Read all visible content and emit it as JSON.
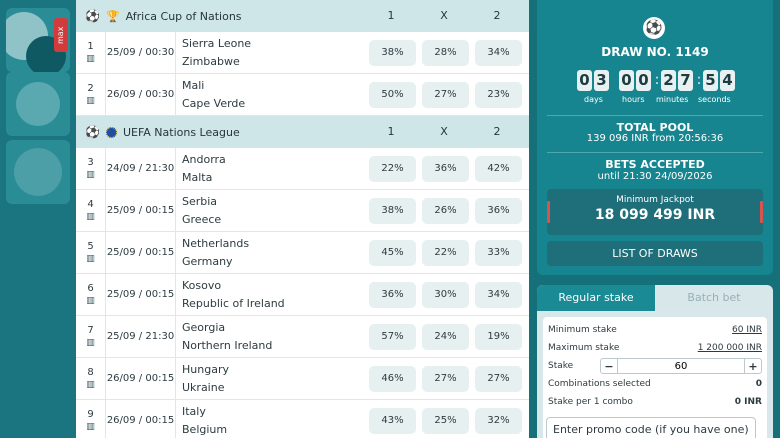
{
  "left_rail": {
    "tiles": [
      {
        "name": "football-tile",
        "badge": "max"
      },
      {
        "name": "cricket-tile"
      },
      {
        "name": "basketball-tile"
      }
    ]
  },
  "columns": {
    "h1": "1",
    "hx": "X",
    "h2": "2"
  },
  "leagues": [
    {
      "name": "Africa Cup of Nations",
      "icon": "trophy-icon",
      "matches": [
        {
          "num": "1",
          "time": "25/09 / 00:30",
          "home": "Sierra Leone",
          "away": "Zimbabwe",
          "p1": "38%",
          "px": "28%",
          "p2": "34%"
        },
        {
          "num": "2",
          "time": "26/09 / 00:30",
          "home": "Mali",
          "away": "Cape Verde",
          "p1": "50%",
          "px": "27%",
          "p2": "23%"
        }
      ]
    },
    {
      "name": "UEFA Nations League",
      "icon": "eu-flag-icon",
      "matches": [
        {
          "num": "3",
          "time": "24/09 / 21:30",
          "home": "Andorra",
          "away": "Malta",
          "p1": "22%",
          "px": "36%",
          "p2": "42%"
        },
        {
          "num": "4",
          "time": "25/09 / 00:15",
          "home": "Serbia",
          "away": "Greece",
          "p1": "38%",
          "px": "26%",
          "p2": "36%"
        },
        {
          "num": "5",
          "time": "25/09 / 00:15",
          "home": "Netherlands",
          "away": "Germany",
          "p1": "45%",
          "px": "22%",
          "p2": "33%"
        },
        {
          "num": "6",
          "time": "25/09 / 00:15",
          "home": "Kosovo",
          "away": "Republic of Ireland",
          "p1": "36%",
          "px": "30%",
          "p2": "34%"
        },
        {
          "num": "7",
          "time": "25/09 / 21:30",
          "home": "Georgia",
          "away": "Northern Ireland",
          "p1": "57%",
          "px": "24%",
          "p2": "19%"
        },
        {
          "num": "8",
          "time": "26/09 / 00:15",
          "home": "Hungary",
          "away": "Ukraine",
          "p1": "46%",
          "px": "27%",
          "p2": "27%"
        },
        {
          "num": "9",
          "time": "26/09 / 00:15",
          "home": "Italy",
          "away": "Belgium",
          "p1": "43%",
          "px": "25%",
          "p2": "32%"
        }
      ]
    }
  ],
  "draw": {
    "title": "DRAW NO. 1149",
    "countdown": {
      "days": "03",
      "hours": "00",
      "minutes": "27",
      "seconds": "54"
    },
    "labels": {
      "days": "days",
      "hours": "hours",
      "minutes": "minutes",
      "seconds": "seconds"
    },
    "pool_title": "TOTAL POOL",
    "pool_value": "139 096 INR from 20:56:36",
    "bets_title": "BETS ACCEPTED",
    "bets_value": "until 21:30 24/09/2026",
    "jackpot_title": "Minimum Jackpot",
    "jackpot_value": "18 099 499 INR",
    "list_button": "LIST OF DRAWS"
  },
  "slip": {
    "tab_regular": "Regular stake",
    "tab_batch": "Batch bet",
    "min_label": "Minimum stake",
    "min_value": "60 INR",
    "max_label": "Maximum stake",
    "max_value": "1 200 000 INR",
    "stake_label": "Stake",
    "stake_value": "60",
    "minus": "−",
    "plus": "+",
    "combos_label": "Combinations selected",
    "combos_value": "0",
    "per_combo_label": "Stake per 1 combo",
    "per_combo_value": "0 INR",
    "promo_placeholder": "Enter promo code (if you have one)"
  },
  "colors": {
    "accent": "#16707a",
    "row_bg": "#cfe6e9",
    "odd_bg": "#e6f0f1",
    "jackpot_bar": "#d9534f"
  }
}
